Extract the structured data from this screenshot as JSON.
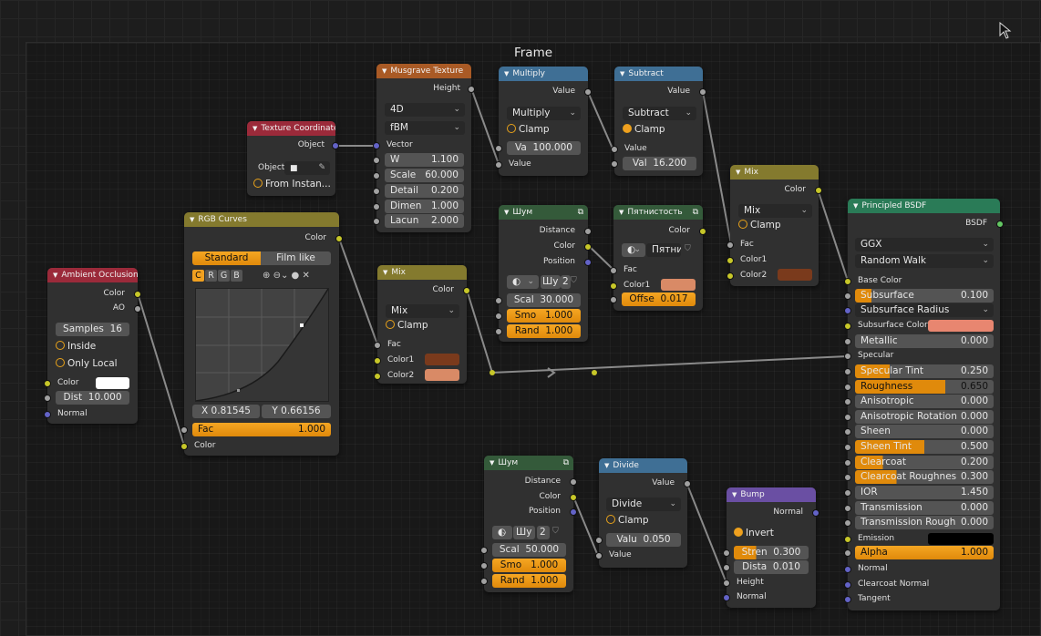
{
  "frame": {
    "title": "Frame"
  },
  "texcoord": {
    "title": "Texture Coordinate",
    "out_object": "Object",
    "object_label": "Object:",
    "from_instancer": "From Instan..."
  },
  "musgrave": {
    "title": "Musgrave Texture",
    "out_height": "Height",
    "dims": "4D",
    "type": "fBM",
    "in_vector": "Vector",
    "w_label": "W",
    "w": "1.100",
    "scale_label": "Scale",
    "scale": "60.000",
    "detail_label": "Detail",
    "detail": "0.200",
    "dimen_label": "Dimen",
    "dimen": "1.000",
    "lacun_label": "Lacun",
    "lacun": "2.000"
  },
  "multiply": {
    "title": "Multiply",
    "out_value": "Value",
    "op": "Multiply",
    "clamp": "Clamp",
    "va_label": "Va",
    "va": "100.000",
    "in_value": "Value"
  },
  "subtract": {
    "title": "Subtract",
    "out_value": "Value",
    "op": "Subtract",
    "clamp": "Clamp",
    "in_value": "Value",
    "val_label": "Val",
    "val": "16.200"
  },
  "ao": {
    "title": "Ambient Occlusion",
    "out_color": "Color",
    "out_ao": "AO",
    "samples_label": "Samples",
    "samples": "16",
    "inside": "Inside",
    "only_local": "Only Local",
    "in_color": "Color",
    "dist_label": "Dist",
    "dist": "10.000",
    "in_normal": "Normal"
  },
  "rgbcurves": {
    "title": "RGB Curves",
    "out_color": "Color",
    "tab_standard": "Standard",
    "tab_filmlike": "Film like",
    "ch_c": "C",
    "ch_r": "R",
    "ch_g": "G",
    "ch_b": "B",
    "x": "X 0.81545",
    "y": "Y 0.66156",
    "fac_label": "Fac",
    "fac": "1.000",
    "in_color": "Color"
  },
  "mix1": {
    "title": "Mix",
    "out_color": "Color",
    "blend": "Mix",
    "clamp": "Clamp",
    "in_fac": "Fac",
    "in_color1": "Color1",
    "in_color2": "Color2",
    "color1": "#7a3a1c",
    "color2": "#d98a66"
  },
  "noise1": {
    "title": "Шум",
    "out_distance": "Distance",
    "out_color": "Color",
    "out_position": "Position",
    "mode": "Шу",
    "dim": "2",
    "scale_label": "Scal",
    "scale": "30.000",
    "smo_label": "Smo",
    "smo": "1.000",
    "rand_label": "Rand",
    "rand": "1.000"
  },
  "spot": {
    "title": "Пятнистость",
    "out_color": "Color",
    "mode": "Пятни",
    "in_fac": "Fac",
    "in_color1": "Color1",
    "offse_label": "Offse",
    "offse": "0.017",
    "color1": "#d98a66"
  },
  "mix2": {
    "title": "Mix",
    "out_color": "Color",
    "blend": "Mix",
    "clamp": "Clamp",
    "in_fac": "Fac",
    "in_color1": "Color1",
    "in_color2": "Color2",
    "color2": "#7a3a1c"
  },
  "bsdf": {
    "title": "Principled BSDF",
    "out_bsdf": "BSDF",
    "distribution": "GGX",
    "sss_method": "Random Walk",
    "base_color": "Base Color",
    "subsurface_label": "Subsurface",
    "subsurface": "0.100",
    "subsurface_radius": "Subsurface Radius",
    "subsurface_color": "Subsurface Color",
    "subsurface_color_value": "#e88670",
    "metallic_label": "Metallic",
    "metallic": "0.000",
    "specular": "Specular",
    "spec_tint_label": "Specular Tint",
    "spec_tint": "0.250",
    "roughness_label": "Roughness",
    "roughness": "0.650",
    "aniso_label": "Anisotropic",
    "aniso": "0.000",
    "aniso_rot_label": "Anisotropic Rotation",
    "aniso_rot": "0.000",
    "sheen_label": "Sheen",
    "sheen": "0.000",
    "sheen_tint_label": "Sheen Tint",
    "sheen_tint": "0.500",
    "clearcoat_label": "Clearcoat",
    "clearcoat": "0.200",
    "cc_rough_label": "Clearcoat Roughnes",
    "cc_rough": "0.300",
    "ior_label": "IOR",
    "ior": "1.450",
    "transmission_label": "Transmission",
    "transmission": "0.000",
    "trans_rough_label": "Transmission Rough",
    "trans_rough": "0.000",
    "emission": "Emission",
    "emission_color": "#000000",
    "alpha_label": "Alpha",
    "alpha": "1.000",
    "normal": "Normal",
    "clearcoat_normal": "Clearcoat Normal",
    "tangent": "Tangent"
  },
  "noise2": {
    "title": "Шум",
    "out_distance": "Distance",
    "out_color": "Color",
    "out_position": "Position",
    "mode": "Шу",
    "dim": "2",
    "scale_label": "Scal",
    "scale": "50.000",
    "smo_label": "Smo",
    "smo": "1.000",
    "rand_label": "Rand",
    "rand": "1.000"
  },
  "divide": {
    "title": "Divide",
    "out_value": "Value",
    "op": "Divide",
    "clamp": "Clamp",
    "valu_label": "Valu",
    "valu": "0.050",
    "in_value": "Value"
  },
  "bump": {
    "title": "Bump",
    "out_normal": "Normal",
    "invert": "Invert",
    "stren_label": "Stren",
    "stren": "0.300",
    "dista_label": "Dista",
    "dista": "0.010",
    "in_height": "Height",
    "in_normal": "Normal"
  }
}
